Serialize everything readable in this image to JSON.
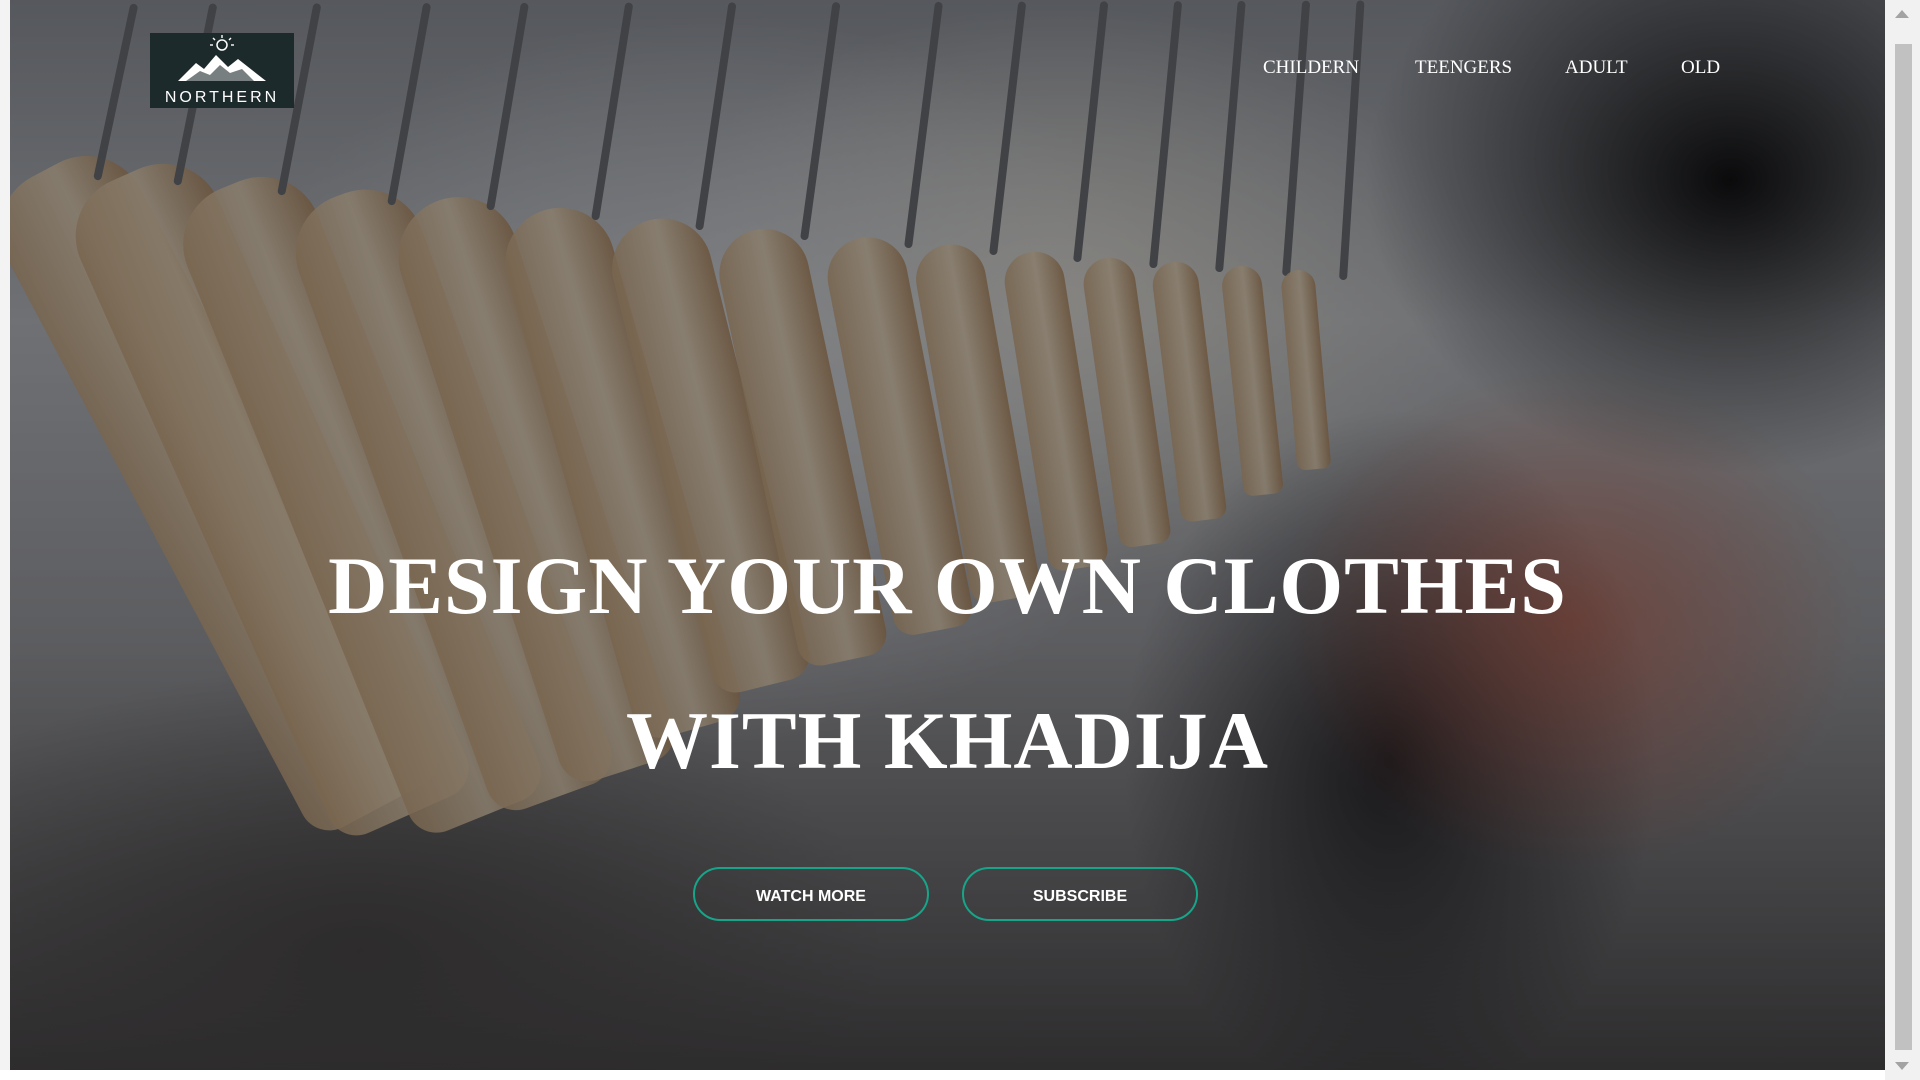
{
  "logo": {
    "text": "NORTHERN",
    "icon": "mountain-logo-icon"
  },
  "nav": {
    "items": [
      {
        "label": "CHILDERN"
      },
      {
        "label": "TEENGERS"
      },
      {
        "label": "ADULT"
      },
      {
        "label": "OLD"
      }
    ]
  },
  "hero": {
    "headline_line1": "DESIGN YOUR OWN CLOTHES",
    "headline_line2": "WITH KHADIJA",
    "background": "clothing-rack-photo"
  },
  "buttons": {
    "watch_more": "WATCH MORE",
    "subscribe": "SUBSCRIBE"
  },
  "colors": {
    "accent": "#17a589",
    "logo_bg": "#1d2a2c",
    "text": "#ffffff"
  }
}
